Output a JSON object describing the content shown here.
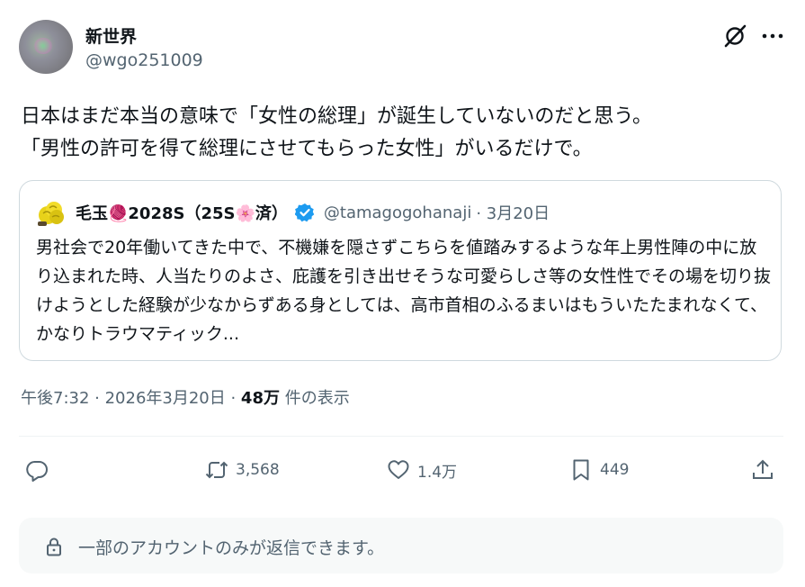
{
  "author": {
    "name": "新世界",
    "handle": "@wgo251009",
    "avatar_icon": "avatar-blurred-icon"
  },
  "tweet": {
    "text": "日本はまだ本当の意味で「女性の総理」が誕生していないのだと思う。\n「男性の許可を得て総理にさせてもらった女性」がいるだけで。"
  },
  "quote": {
    "name": "毛玉🧶2028S（25S🌸済）",
    "handle": "@tamagogohanaji",
    "date": "· 3月20日",
    "verified_icon": "verified-badge-icon",
    "text": "男社会で20年働いてきた中で、不機嫌を隠さずこちらを値踏みするような年上男性陣の中に放り込まれた時、人当たりのよさ、庇護を引き出せそうな可愛らしさ等の女性性でその場を切り抜けようとした経験が少なからずある身としては、高市首相のふるまいはもういたたまれなくて、かなりトラウマティック..."
  },
  "meta": {
    "time": "午後7:32 · 2026年3月20日 · ",
    "views": "48万",
    "views_suffix": " 件の表示"
  },
  "actions": {
    "reply_count": "",
    "retweet_count": "3,568",
    "like_count": "1.4万",
    "bookmark_count": "449"
  },
  "reply_restriction": {
    "text": "一部のアカウントのみが返信できます。",
    "icon": "lock-icon"
  },
  "colors": {
    "text": "#0f1419",
    "secondary": "#536471",
    "verified": "#1d9bf0",
    "border": "#cfd9de",
    "reply_bg": "#f7f9f9"
  }
}
